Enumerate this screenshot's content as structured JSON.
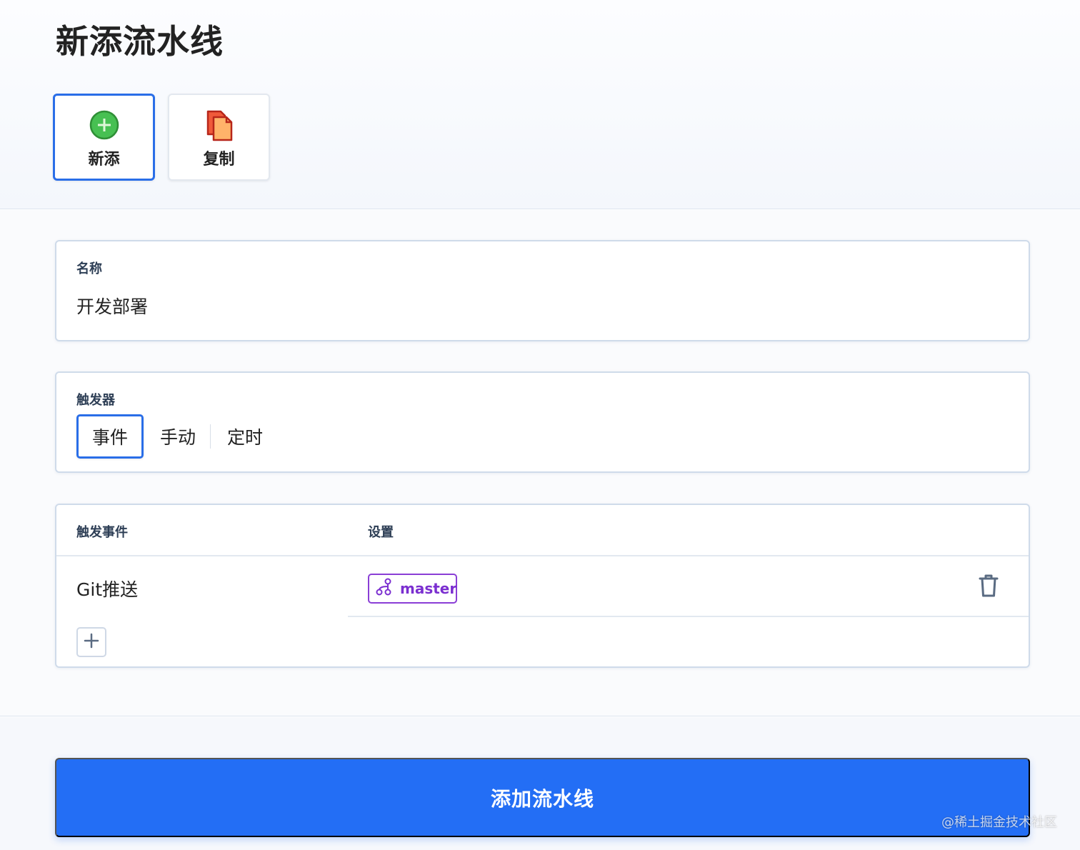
{
  "header": {
    "title": "新添流水线"
  },
  "mode_options": [
    {
      "label": "新添",
      "icon": "plus-circle-icon",
      "active": true
    },
    {
      "label": "复制",
      "icon": "copy-documents-icon",
      "active": false
    }
  ],
  "name_section": {
    "label": "名称",
    "value": "开发部署"
  },
  "trigger_section": {
    "label": "触发器",
    "options": [
      "事件",
      "手动",
      "定时"
    ],
    "selected": "事件"
  },
  "events_table": {
    "headers": {
      "event": "触发事件",
      "settings": "设置"
    },
    "rows": [
      {
        "event": "Git推送",
        "branch": "master",
        "branch_icon": "git-branch-icon",
        "delete_icon": "trash-icon"
      }
    ],
    "add_icon": "plus-icon"
  },
  "submit": {
    "label": "添加流水线"
  },
  "watermark": "@稀土掘金技术社区",
  "colors": {
    "accent": "#236ef5",
    "active_border": "#2a6ee8",
    "branch": "#7b2fd0",
    "add_green": "#3bb54a",
    "copy_red": "#e2402b"
  }
}
